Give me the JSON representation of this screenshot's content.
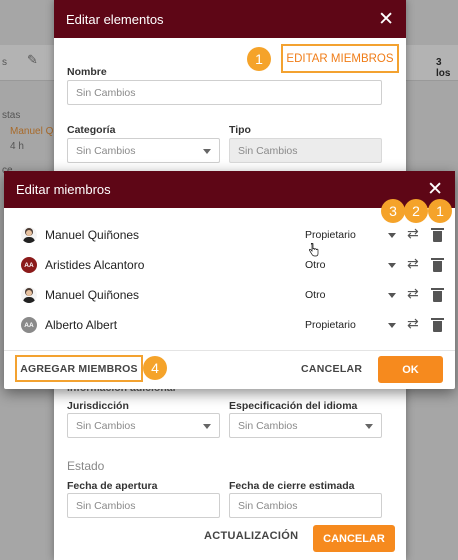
{
  "background": {
    "left_snippets": [
      "s",
      "stas",
      "Manuel Q",
      "4 h",
      "ce"
    ],
    "right_snippets": [
      "3 los"
    ]
  },
  "edit_dialog": {
    "title": "Editar elementos",
    "editar_miembros_label": "EDITAR MIEMBROS",
    "fields": {
      "nombre_label": "Nombre",
      "nombre_placeholder": "Sin Cambios",
      "categoria_label": "Categoría",
      "categoria_value": "Sin Cambios",
      "tipo_label": "Tipo",
      "tipo_value": "Sin Cambios",
      "info_adicional_label": "Información adicional",
      "jurisdiccion_label": "Jurisdicción",
      "jurisdiccion_value": "Sin Cambios",
      "especificacion_label": "Especificación del idioma",
      "especificacion_value": "Sin Cambios",
      "estado_label": "Estado",
      "fecha_apertura_label": "Fecha de apertura",
      "fecha_apertura_placeholder": "Sin Cambios",
      "fecha_cierre_label": "Fecha de cierre estimada",
      "fecha_cierre_placeholder": "Sin Cambios"
    },
    "footer": {
      "actualizacion_label": "ACTUALIZACIÓN",
      "cancelar_label": "CANCELAR"
    }
  },
  "members_dialog": {
    "title": "Editar miembros",
    "members": [
      {
        "name": "Manuel Quiñones",
        "role": "Propietario",
        "avatar": "photo"
      },
      {
        "name": "Aristides Alcantoro",
        "role": "Otro",
        "avatar": "initials",
        "initials": "AA",
        "avatar_color": "#8b1a1a"
      },
      {
        "name": "Manuel Quiñones",
        "role": "Otro",
        "avatar": "photo"
      },
      {
        "name": "Alberto Albert",
        "role": "Propietario",
        "avatar": "initials",
        "initials": "AA",
        "avatar_color": "#8a8a8a"
      }
    ],
    "footer": {
      "agregar_label": "AGREGAR MIEMBROS",
      "cancelar_label": "CANCELAR",
      "ok_label": "OK"
    }
  },
  "badges": {
    "editar_miembros": "1",
    "change_role": "3",
    "swap": "2",
    "delete": "1",
    "agregar": "4"
  },
  "colors": {
    "header": "#5e0616",
    "accent": "#f68a1e",
    "badge": "#f5a32a"
  }
}
